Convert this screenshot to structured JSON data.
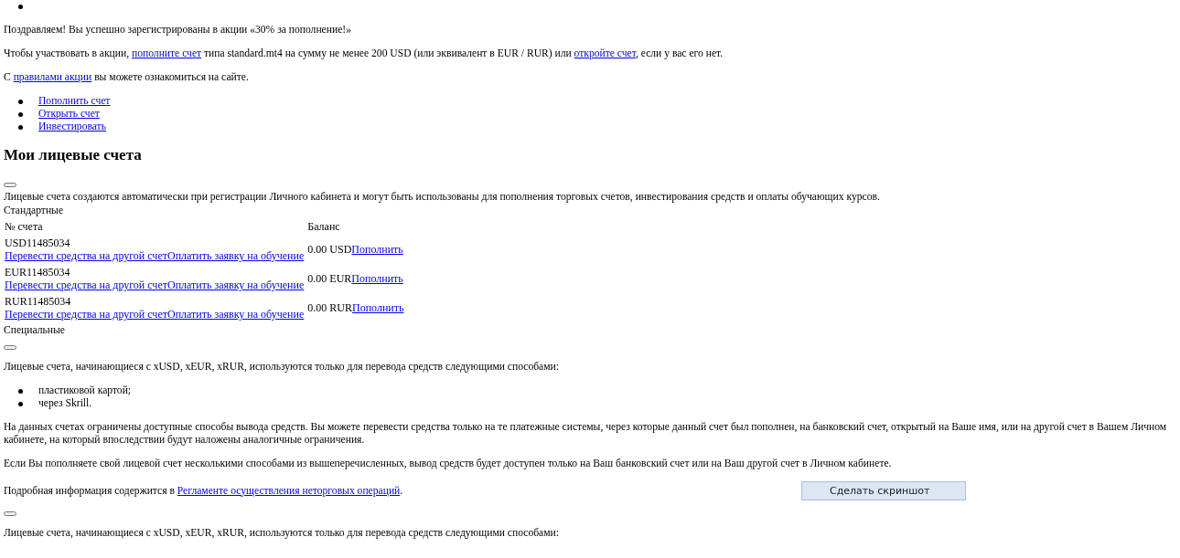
{
  "intro": [
    [
      {
        "kind": "text",
        "text": "Поздравляем! Вы успешно зарегистрированы в акции «30% за пополнение!»"
      }
    ],
    [
      {
        "kind": "text",
        "text": "Чтобы участвовать в акции, "
      },
      {
        "kind": "link",
        "text": "пополните счет"
      },
      {
        "kind": "text",
        "text": " типа standard.mt4 на сумму не менее 200 USD (или эквивалент в EUR / RUR) или "
      },
      {
        "kind": "link",
        "text": "откройте счет"
      },
      {
        "kind": "text",
        "text": ", если у вас его нет."
      }
    ],
    [
      {
        "kind": "text",
        "text": "С "
      },
      {
        "kind": "link",
        "text": "правилами акции"
      },
      {
        "kind": "text",
        "text": " вы можете ознакомиться на сайте."
      }
    ]
  ],
  "actions": [
    "Пополнить счет",
    "Открыть счет",
    "Инвестировать"
  ],
  "heading": "Мои лицевые счета",
  "description": "Лицевые счета создаются автоматически при регистрации Личного кабинета и могут быть использованы для пополнения торговых счетов, инвестирования средств и оплаты обучающих курсов.",
  "standard_label": "Стандартные",
  "table": {
    "columns": [
      "№ счета",
      "Баланс"
    ],
    "rows": [
      {
        "account": "USD11485034",
        "links": [
          "Перевести средства на другой счет",
          "Оплатить заявку на обучение"
        ],
        "balance": "0.00 USD",
        "action": "Пополнить"
      },
      {
        "account": "EUR11485034",
        "links": [
          "Перевести средства на другой счет",
          "Оплатить заявку на обучение"
        ],
        "balance": "0.00 EUR",
        "action": "Пополнить"
      },
      {
        "account": "RUR11485034",
        "links": [
          "Перевести средства на другой счет",
          "Оплатить заявку на обучение"
        ],
        "balance": "0.00 RUR",
        "action": "Пополнить"
      }
    ]
  },
  "special_label": "Специальные",
  "special": [
    {
      "kind": "toggle"
    },
    {
      "kind": "para",
      "parts": [
        {
          "kind": "text",
          "text": "Лицевые счета, начинающиеся с xUSD, xEUR, xRUR, используются только для перевода средств следующими способами:"
        }
      ]
    },
    {
      "kind": "list",
      "items": [
        "пластиковой картой;",
        "через Skrill."
      ]
    },
    {
      "kind": "para",
      "parts": [
        {
          "kind": "text",
          "text": "На данных счетах ограничены доступные способы вывода средств. Вы можете перевести средства только на те платежные системы, через которые данный счет был пополнен, на банковский счет, открытый на Ваше имя, или на другой счет в Вашем Личном кабинете, на который впоследствии будут наложены аналогичные ограничения."
        }
      ]
    },
    {
      "kind": "para",
      "parts": [
        {
          "kind": "text",
          "text": "Если Вы пополняете свой лицевой счет несколькими способами из вышеперечисленных, вывод средств будет доступен только на Ваш банковский счет или на Ваш другой счет в Личном кабинете."
        }
      ]
    },
    {
      "kind": "para",
      "parts": [
        {
          "kind": "text",
          "text": "Подробная информация содержится в "
        },
        {
          "kind": "link",
          "text": "Регламенте осуществления неторговых операций"
        },
        {
          "kind": "text",
          "text": "."
        }
      ],
      "button": "Сделать скриншот"
    },
    {
      "kind": "toggle"
    },
    {
      "kind": "para",
      "parts": [
        {
          "kind": "text",
          "text": "Лицевые счета, начинающиеся с xUSD, xEUR, xRUR, используются только для перевода средств следующими способами:"
        }
      ]
    }
  ]
}
